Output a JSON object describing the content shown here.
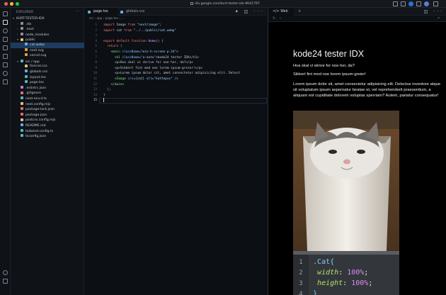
{
  "browser": {
    "url": "idx.google.com/kurt-tester-idx-9641797"
  },
  "explorer": {
    "title": "EXPLORER",
    "project": "KURT-TESTER-IDX",
    "items": [
      {
        "label": "KURT-TESTER-IDX",
        "depth": 0,
        "chev": "▾",
        "color": ""
      },
      {
        "label": ".idx",
        "depth": 1,
        "chev": "›",
        "color": "#8b929c"
      },
      {
        "label": ".next",
        "depth": 1,
        "chev": "›",
        "color": "#8b929c"
      },
      {
        "label": "node_modules",
        "depth": 1,
        "chev": "›",
        "color": "#8b929c"
      },
      {
        "label": "public",
        "depth": 1,
        "chev": "▾",
        "color": "#e5c07b"
      },
      {
        "label": "cat.webp",
        "depth": 2,
        "chev": "",
        "color": "#61afef"
      },
      {
        "label": "next.svg",
        "depth": 2,
        "chev": "",
        "color": "#e5a13b"
      },
      {
        "label": "vercel.svg",
        "depth": 2,
        "chev": "",
        "color": "#e5a13b"
      },
      {
        "label": "src / app",
        "depth": 1,
        "chev": "▾",
        "color": "#56b6c2"
      },
      {
        "label": "favicon.ico",
        "depth": 2,
        "chev": "",
        "color": "#e5c07b"
      },
      {
        "label": "globals.css",
        "depth": 2,
        "chev": "",
        "color": "#61afef"
      },
      {
        "label": "layout.tsx",
        "depth": 2,
        "chev": "",
        "color": "#56b6c2"
      },
      {
        "label": "page.tsx",
        "depth": 2,
        "chev": "",
        "color": "#56b6c2"
      },
      {
        "label": ".eslintrc.json",
        "depth": 1,
        "chev": "",
        "color": "#c678dd"
      },
      {
        "label": ".gitignore",
        "depth": 1,
        "chev": "",
        "color": "#e06c75"
      },
      {
        "label": "next-env.d.ts",
        "depth": 1,
        "chev": "",
        "color": "#56b6c2"
      },
      {
        "label": "next.config.mjs",
        "depth": 1,
        "chev": "",
        "color": "#e5c07b"
      },
      {
        "label": "package-lock.json",
        "depth": 1,
        "chev": "",
        "color": "#e06c75"
      },
      {
        "label": "package.json",
        "depth": 1,
        "chev": "",
        "color": "#e06c75"
      },
      {
        "label": "postcss.config.mjs",
        "depth": 1,
        "chev": "",
        "color": "#e5c07b"
      },
      {
        "label": "README.md",
        "depth": 1,
        "chev": "",
        "color": "#61afef"
      },
      {
        "label": "tailwind.config.ts",
        "depth": 1,
        "chev": "",
        "color": "#56b6c2"
      },
      {
        "label": "tsconfig.json",
        "depth": 1,
        "chev": "",
        "color": "#56b6c2"
      }
    ],
    "selected_index": 5
  },
  "editor": {
    "tabs": [
      "page.tsx",
      "globals.css"
    ],
    "breadcrumb": "src › app › page.tsx › ...",
    "line_numbers": [
      "1",
      "2",
      "3",
      "4",
      "5",
      "6",
      "7",
      "8",
      "9",
      "10",
      "11",
      "12",
      "13",
      "14",
      "15"
    ],
    "current_line": "15"
  },
  "preview": {
    "tab_label": "Web",
    "page_title": "kode24 tester IDX",
    "p1": "Hva skal vi skrive for noe her, da?",
    "p2": "Sikkert fint med noe lorem ipsum-greier!",
    "p3": "Lorem ipsum dolor sit, amet consectetur adipisicing elit. Delectus inventore atque sit voluptatum ipsum aspernatur beatae et, vel reprehenderit praesentium, a aliquam est cupiditate dolorem voluptas sperriam? Autem, pariatur consequatur!",
    "image_alt": "katt",
    "code_card": {
      "lines": [
        {
          "n": "1",
          "text": ".Cat{"
        },
        {
          "n": "2",
          "prop": "width",
          "val": "100%"
        },
        {
          "n": "3",
          "prop": "height",
          "val": "100%"
        },
        {
          "n": "4",
          "text": "}"
        }
      ]
    }
  },
  "colors": {
    "accent": "#1f3a5f",
    "keyword": "#ff7b72",
    "string": "#a5d6ff",
    "tag": "#7ee787"
  }
}
